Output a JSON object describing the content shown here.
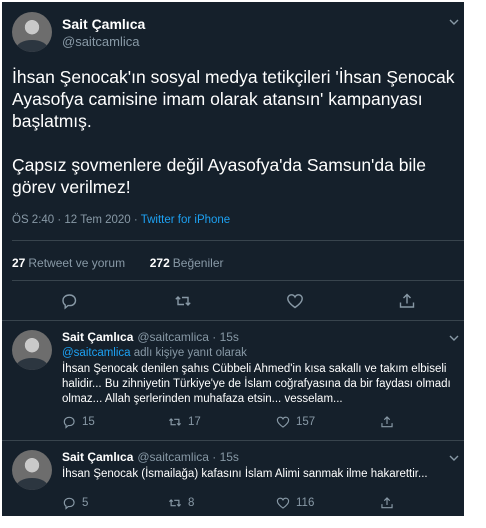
{
  "main_tweet": {
    "author_name": "Sait Çamlıca",
    "author_handle": "@saitcamlica",
    "text": "İhsan Şenocak'ın sosyal medya tetikçileri 'İhsan Şenocak Ayasofya camisine imam olarak atansın' kampanyası başlatmış.\n\nÇapsız şovmenlere değil Ayasofya'da Samsun'da bile görev verilmez!",
    "time": "ÖS 2:40 · 12 Tem 2020 · ",
    "source": "Twitter for iPhone",
    "retweet_count": "27",
    "retweet_label": "Retweet ve yorum",
    "like_count": "272",
    "like_label": "Beğeniler"
  },
  "replies": [
    {
      "author_name": "Sait Çamlıca",
      "author_handle": "@saitcamlica · 15s",
      "replying_mention": "@saitcamlica",
      "replying_suffix": " adlı kişiye yanıt olarak",
      "text": "İhsan Şenocak denilen şahıs Cübbeli Ahmed'in kısa sakallı ve takım elbiseli halidir... Bu zihniyetin Türkiye'ye de İslam coğrafyasına da bir faydası olmadı olmaz... Allah şerlerinden muhafaza etsin... vesselam...",
      "reply_count": "15",
      "retweet_count": "17",
      "like_count": "157"
    },
    {
      "author_name": "Sait Çamlıca",
      "author_handle": "@saitcamlica · 15s",
      "text": "İhsan Şenocak (İsmailağa) kafasını İslam Alimi sanmak ilme hakarettir...",
      "reply_count": "5",
      "retweet_count": "8",
      "like_count": "116"
    }
  ],
  "icons": [
    "reply-icon",
    "retweet-icon",
    "like-icon",
    "share-icon",
    "chevron-down-icon"
  ],
  "colors": {
    "background": "#15202b",
    "accent": "#1da1f2",
    "secondary_text": "#8899a6",
    "divider": "#38444d"
  }
}
